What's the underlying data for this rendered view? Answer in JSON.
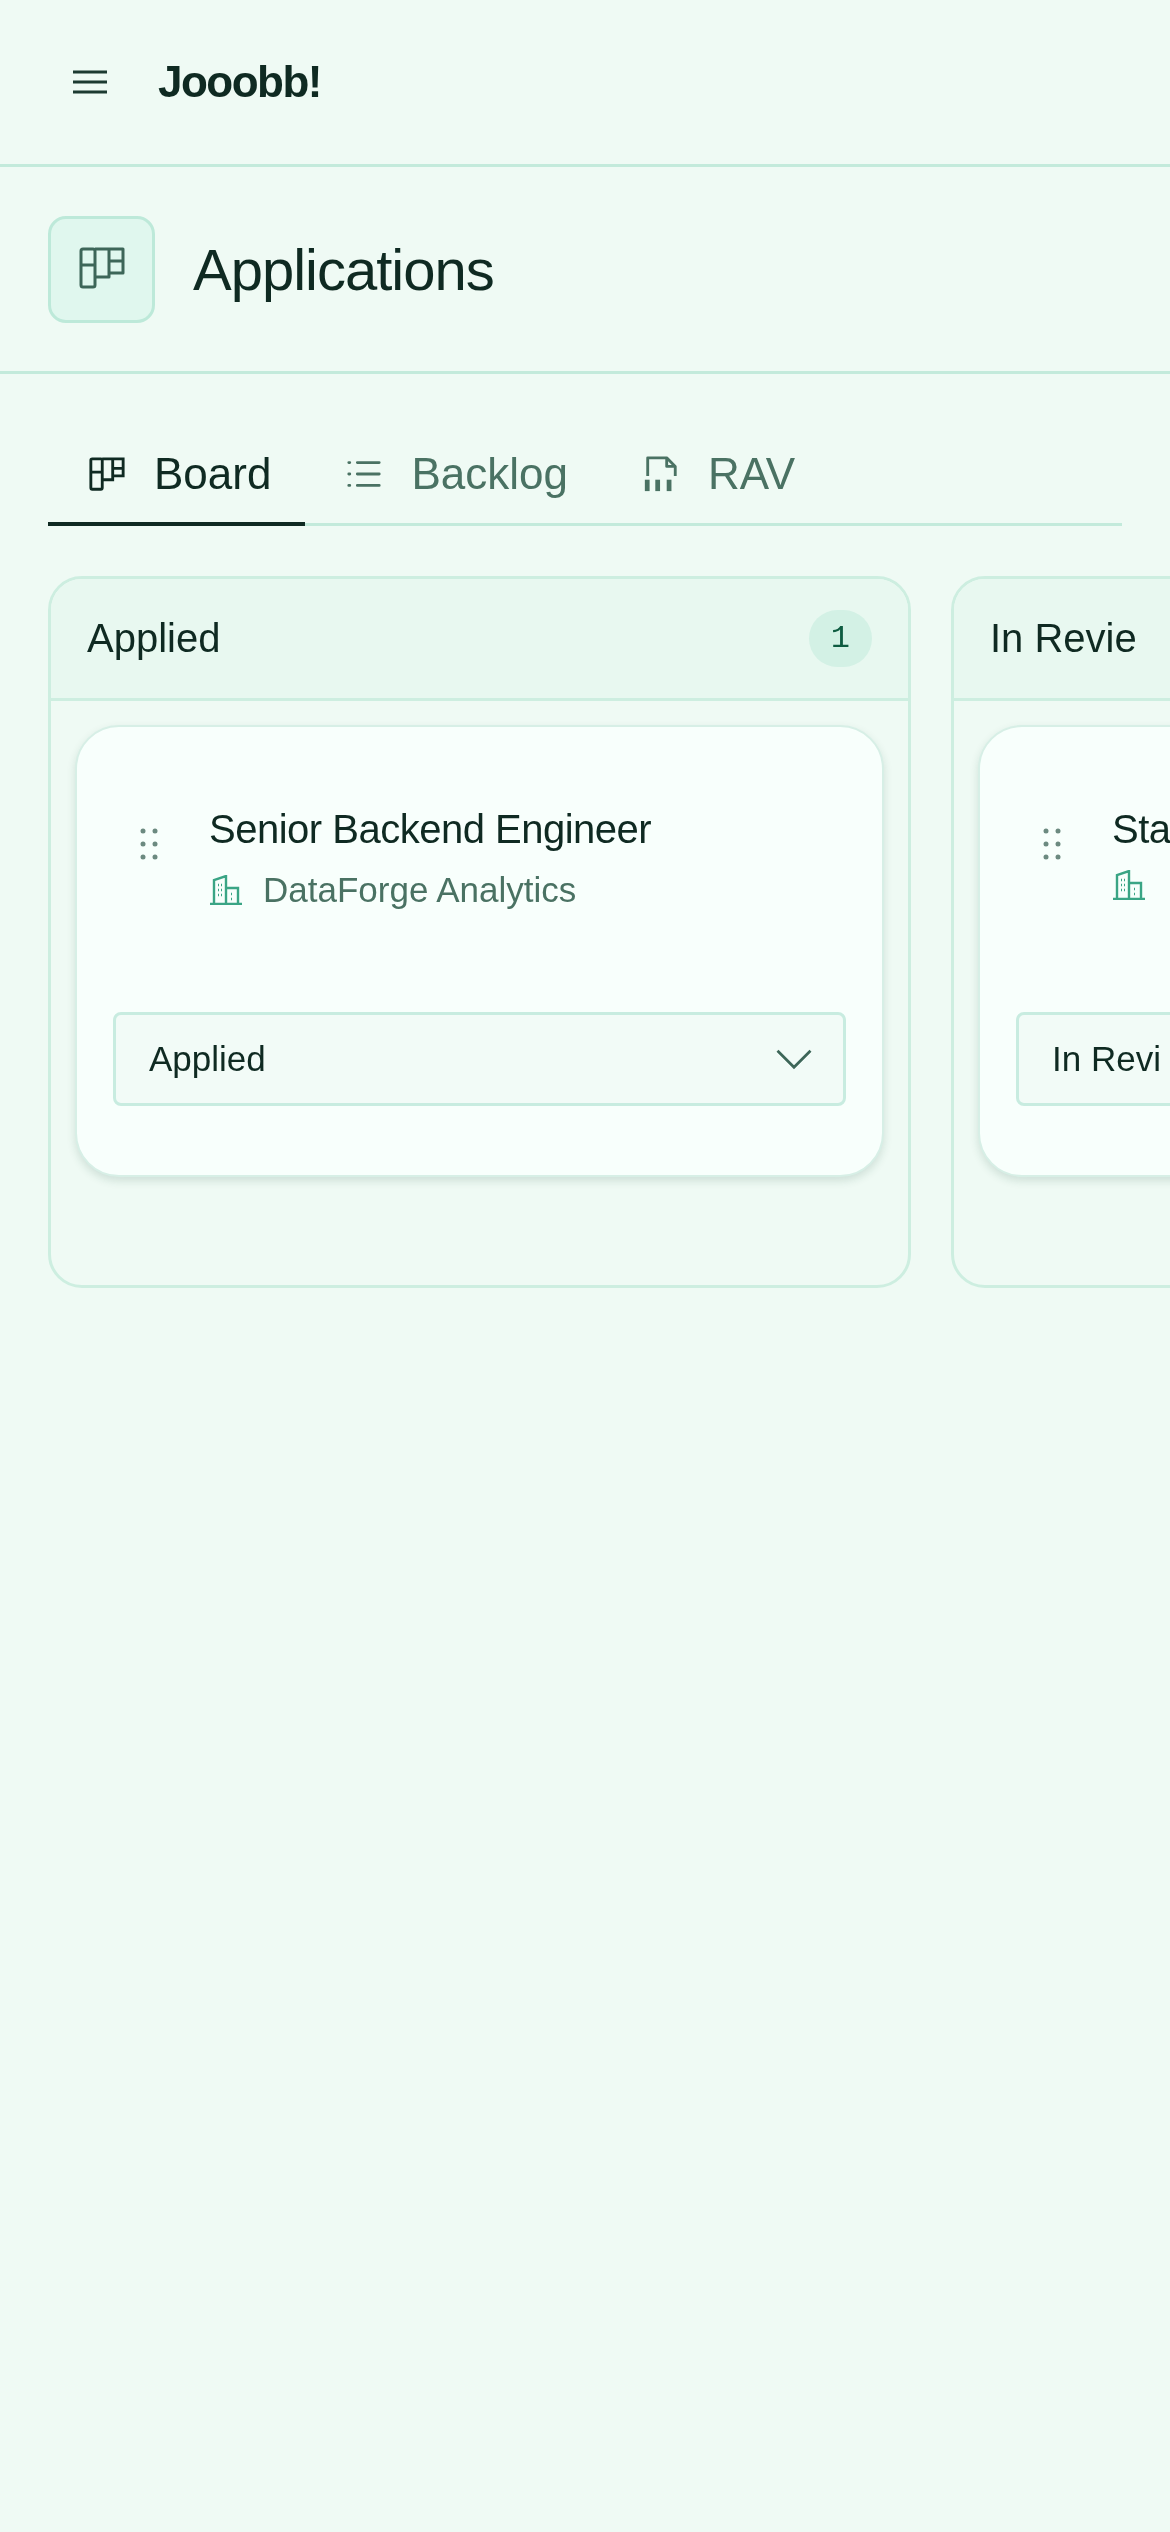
{
  "app_bar": {
    "title": "Jooobb!"
  },
  "page_header": {
    "title": "Applications"
  },
  "tabs": [
    {
      "label": "Board",
      "kind": "board",
      "selected": true
    },
    {
      "label": "Backlog",
      "kind": "list",
      "selected": false
    },
    {
      "label": "RAV",
      "kind": "pdf",
      "selected": false
    }
  ],
  "columns": [
    {
      "title": "Applied",
      "count": "1",
      "cards": [
        {
          "title": "Senior Backend Engineer",
          "company": "DataForge Analytics",
          "status": "Applied"
        }
      ]
    },
    {
      "title": "In Revie",
      "cards": [
        {
          "title": "Sta",
          "status": "In Revi"
        }
      ]
    }
  ]
}
